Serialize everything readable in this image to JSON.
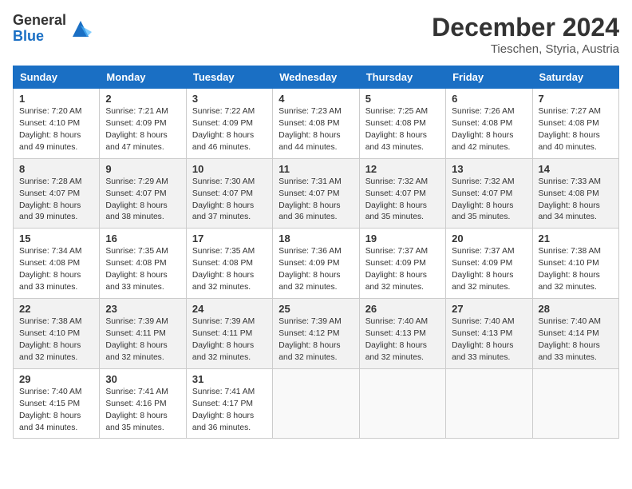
{
  "logo": {
    "general": "General",
    "blue": "Blue"
  },
  "header": {
    "month": "December 2024",
    "location": "Tieschen, Styria, Austria"
  },
  "weekdays": [
    "Sunday",
    "Monday",
    "Tuesday",
    "Wednesday",
    "Thursday",
    "Friday",
    "Saturday"
  ],
  "weeks": [
    [
      {
        "day": "1",
        "sunrise": "Sunrise: 7:20 AM",
        "sunset": "Sunset: 4:10 PM",
        "daylight": "Daylight: 8 hours and 49 minutes."
      },
      {
        "day": "2",
        "sunrise": "Sunrise: 7:21 AM",
        "sunset": "Sunset: 4:09 PM",
        "daylight": "Daylight: 8 hours and 47 minutes."
      },
      {
        "day": "3",
        "sunrise": "Sunrise: 7:22 AM",
        "sunset": "Sunset: 4:09 PM",
        "daylight": "Daylight: 8 hours and 46 minutes."
      },
      {
        "day": "4",
        "sunrise": "Sunrise: 7:23 AM",
        "sunset": "Sunset: 4:08 PM",
        "daylight": "Daylight: 8 hours and 44 minutes."
      },
      {
        "day": "5",
        "sunrise": "Sunrise: 7:25 AM",
        "sunset": "Sunset: 4:08 PM",
        "daylight": "Daylight: 8 hours and 43 minutes."
      },
      {
        "day": "6",
        "sunrise": "Sunrise: 7:26 AM",
        "sunset": "Sunset: 4:08 PM",
        "daylight": "Daylight: 8 hours and 42 minutes."
      },
      {
        "day": "7",
        "sunrise": "Sunrise: 7:27 AM",
        "sunset": "Sunset: 4:08 PM",
        "daylight": "Daylight: 8 hours and 40 minutes."
      }
    ],
    [
      {
        "day": "8",
        "sunrise": "Sunrise: 7:28 AM",
        "sunset": "Sunset: 4:07 PM",
        "daylight": "Daylight: 8 hours and 39 minutes."
      },
      {
        "day": "9",
        "sunrise": "Sunrise: 7:29 AM",
        "sunset": "Sunset: 4:07 PM",
        "daylight": "Daylight: 8 hours and 38 minutes."
      },
      {
        "day": "10",
        "sunrise": "Sunrise: 7:30 AM",
        "sunset": "Sunset: 4:07 PM",
        "daylight": "Daylight: 8 hours and 37 minutes."
      },
      {
        "day": "11",
        "sunrise": "Sunrise: 7:31 AM",
        "sunset": "Sunset: 4:07 PM",
        "daylight": "Daylight: 8 hours and 36 minutes."
      },
      {
        "day": "12",
        "sunrise": "Sunrise: 7:32 AM",
        "sunset": "Sunset: 4:07 PM",
        "daylight": "Daylight: 8 hours and 35 minutes."
      },
      {
        "day": "13",
        "sunrise": "Sunrise: 7:32 AM",
        "sunset": "Sunset: 4:07 PM",
        "daylight": "Daylight: 8 hours and 35 minutes."
      },
      {
        "day": "14",
        "sunrise": "Sunrise: 7:33 AM",
        "sunset": "Sunset: 4:08 PM",
        "daylight": "Daylight: 8 hours and 34 minutes."
      }
    ],
    [
      {
        "day": "15",
        "sunrise": "Sunrise: 7:34 AM",
        "sunset": "Sunset: 4:08 PM",
        "daylight": "Daylight: 8 hours and 33 minutes."
      },
      {
        "day": "16",
        "sunrise": "Sunrise: 7:35 AM",
        "sunset": "Sunset: 4:08 PM",
        "daylight": "Daylight: 8 hours and 33 minutes."
      },
      {
        "day": "17",
        "sunrise": "Sunrise: 7:35 AM",
        "sunset": "Sunset: 4:08 PM",
        "daylight": "Daylight: 8 hours and 32 minutes."
      },
      {
        "day": "18",
        "sunrise": "Sunrise: 7:36 AM",
        "sunset": "Sunset: 4:09 PM",
        "daylight": "Daylight: 8 hours and 32 minutes."
      },
      {
        "day": "19",
        "sunrise": "Sunrise: 7:37 AM",
        "sunset": "Sunset: 4:09 PM",
        "daylight": "Daylight: 8 hours and 32 minutes."
      },
      {
        "day": "20",
        "sunrise": "Sunrise: 7:37 AM",
        "sunset": "Sunset: 4:09 PM",
        "daylight": "Daylight: 8 hours and 32 minutes."
      },
      {
        "day": "21",
        "sunrise": "Sunrise: 7:38 AM",
        "sunset": "Sunset: 4:10 PM",
        "daylight": "Daylight: 8 hours and 32 minutes."
      }
    ],
    [
      {
        "day": "22",
        "sunrise": "Sunrise: 7:38 AM",
        "sunset": "Sunset: 4:10 PM",
        "daylight": "Daylight: 8 hours and 32 minutes."
      },
      {
        "day": "23",
        "sunrise": "Sunrise: 7:39 AM",
        "sunset": "Sunset: 4:11 PM",
        "daylight": "Daylight: 8 hours and 32 minutes."
      },
      {
        "day": "24",
        "sunrise": "Sunrise: 7:39 AM",
        "sunset": "Sunset: 4:11 PM",
        "daylight": "Daylight: 8 hours and 32 minutes."
      },
      {
        "day": "25",
        "sunrise": "Sunrise: 7:39 AM",
        "sunset": "Sunset: 4:12 PM",
        "daylight": "Daylight: 8 hours and 32 minutes."
      },
      {
        "day": "26",
        "sunrise": "Sunrise: 7:40 AM",
        "sunset": "Sunset: 4:13 PM",
        "daylight": "Daylight: 8 hours and 32 minutes."
      },
      {
        "day": "27",
        "sunrise": "Sunrise: 7:40 AM",
        "sunset": "Sunset: 4:13 PM",
        "daylight": "Daylight: 8 hours and 33 minutes."
      },
      {
        "day": "28",
        "sunrise": "Sunrise: 7:40 AM",
        "sunset": "Sunset: 4:14 PM",
        "daylight": "Daylight: 8 hours and 33 minutes."
      }
    ],
    [
      {
        "day": "29",
        "sunrise": "Sunrise: 7:40 AM",
        "sunset": "Sunset: 4:15 PM",
        "daylight": "Daylight: 8 hours and 34 minutes."
      },
      {
        "day": "30",
        "sunrise": "Sunrise: 7:41 AM",
        "sunset": "Sunset: 4:16 PM",
        "daylight": "Daylight: 8 hours and 35 minutes."
      },
      {
        "day": "31",
        "sunrise": "Sunrise: 7:41 AM",
        "sunset": "Sunset: 4:17 PM",
        "daylight": "Daylight: 8 hours and 36 minutes."
      },
      null,
      null,
      null,
      null
    ]
  ]
}
